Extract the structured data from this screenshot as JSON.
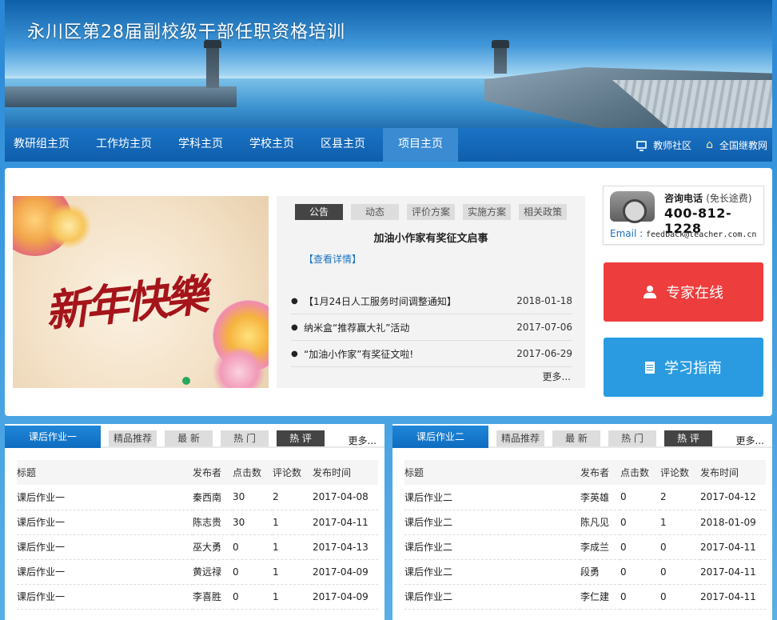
{
  "header": {
    "title": "永川区第28届副校级干部任职资格培训"
  },
  "nav": {
    "items": [
      "教研组主页",
      "工作坊主页",
      "学科主页",
      "学校主页",
      "区县主页",
      "项目主页"
    ],
    "active_index": 5,
    "right_links": [
      {
        "label": "教师社区",
        "icon": "monitor-icon"
      },
      {
        "label": "全国继教网",
        "icon": "home-icon"
      }
    ]
  },
  "slideshow": {
    "text": "新年快樂"
  },
  "news": {
    "tabs": [
      "公告",
      "动态",
      "评价方案",
      "实施方案",
      "相关政策"
    ],
    "active_tab": 0,
    "headline": "加油小作家有奖征文启事",
    "detail_link": "【查看详情】",
    "items": [
      {
        "title": "【1月24日人工服务时间调整通知】",
        "date": "2018-01-18"
      },
      {
        "title": "纳米盒“推荐赢大礼”活动",
        "date": "2017-07-06"
      },
      {
        "title": "“加油小作家”有奖征文啦!",
        "date": "2017-06-29"
      }
    ],
    "more": "更多..."
  },
  "hotline": {
    "label": "咨询电话",
    "note": "(免长途费)",
    "number": "400-812-1228",
    "email_label": "Email :",
    "email": "feedback@teacher.com.cn"
  },
  "buttons": {
    "expert": "专家在线",
    "guide": "学习指南"
  },
  "colors": {
    "expert": "#ee3d3d",
    "guide": "#2a9be0",
    "nav": "#0f5eac"
  },
  "homework": [
    {
      "name": "课后作业一",
      "tabs": [
        "精品推荐",
        "最 新",
        "热 门",
        "热 评"
      ],
      "active_tab": 3,
      "more": "更多...",
      "columns": [
        "标题",
        "发布者",
        "点击数",
        "评论数",
        "发布时间"
      ],
      "rows": [
        [
          "课后作业一",
          "秦西南",
          "30",
          "2",
          "2017-04-08"
        ],
        [
          "课后作业一",
          "陈志贵",
          "30",
          "1",
          "2017-04-11"
        ],
        [
          "课后作业一",
          "巫大勇",
          "0",
          "1",
          "2017-04-13"
        ],
        [
          "课后作业一",
          "黄远禄",
          "0",
          "1",
          "2017-04-09"
        ],
        [
          "课后作业一",
          "李喜胜",
          "0",
          "1",
          "2017-04-09"
        ]
      ]
    },
    {
      "name": "课后作业二",
      "tabs": [
        "精品推荐",
        "最 新",
        "热 门",
        "热 评"
      ],
      "active_tab": 3,
      "more": "更多...",
      "columns": [
        "标题",
        "发布者",
        "点击数",
        "评论数",
        "发布时间"
      ],
      "rows": [
        [
          "课后作业二",
          "李英雄",
          "0",
          "2",
          "2017-04-12"
        ],
        [
          "课后作业二",
          "陈凡见",
          "0",
          "1",
          "2018-01-09"
        ],
        [
          "课后作业二",
          "李成兰",
          "0",
          "0",
          "2017-04-11"
        ],
        [
          "课后作业二",
          "段勇",
          "0",
          "0",
          "2017-04-11"
        ],
        [
          "课后作业二",
          "李仁建",
          "0",
          "0",
          "2017-04-11"
        ]
      ]
    }
  ]
}
